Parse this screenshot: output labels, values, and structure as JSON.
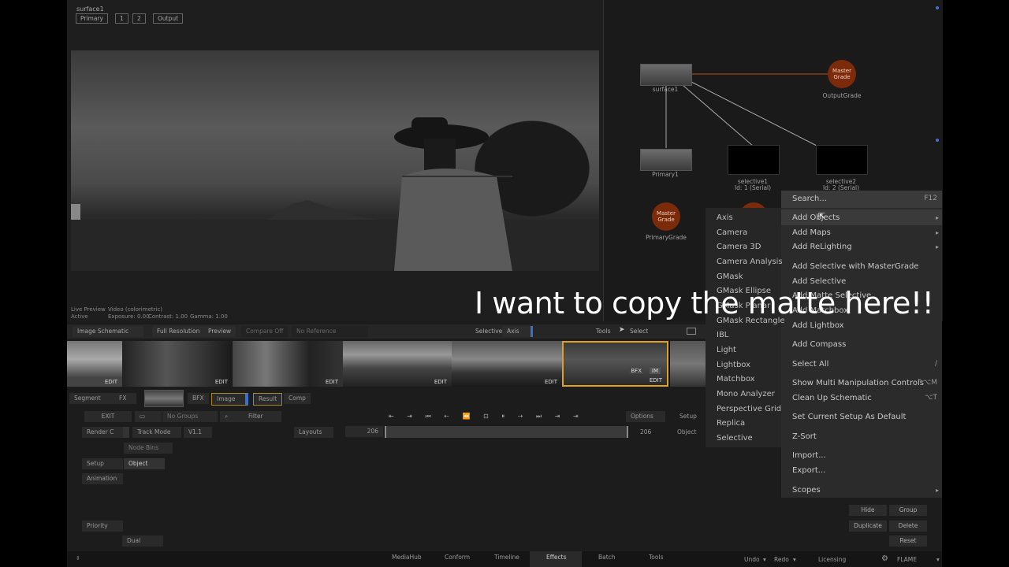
{
  "viewer": {
    "surface_label": "surface1",
    "buttons": [
      "Primary",
      "1",
      "2",
      "Output"
    ],
    "live_preview": "Live Preview",
    "video_mode": "Video (colorimetric)",
    "active": "Active",
    "exposure": "Exposure: 0.00",
    "contrast": "Contrast: 1.00",
    "gamma": "Gamma: 1.00"
  },
  "schematic": {
    "nodes": {
      "surface1": "surface1",
      "output_grade": "OutputGrade",
      "master_grade": "Master Grade",
      "primary1": "Primary1",
      "selective1_name": "selective1",
      "selective1_id": "Id: 1 (Serial)",
      "selective2_name": "selective2",
      "selective2_id": "Id: 2 (Serial)",
      "primary_grade": "PrimaryGrade",
      "primary_grade_circle": "Master Grade"
    }
  },
  "toolbar": {
    "image_schematic": "Image Schematic",
    "full_resolution": "Full Resolution",
    "preview": "Preview",
    "compare_off": "Compare Off",
    "no_reference": "No Reference",
    "selective_label": "Selective",
    "selective_value": "Axis",
    "tools_label": "Tools",
    "select_label": "Select"
  },
  "reel": {
    "edit_labels": [
      "EDIT",
      "EDIT",
      "EDIT",
      "EDIT",
      "EDIT",
      "EDIT"
    ],
    "badges": [
      "BFX",
      "IM"
    ]
  },
  "controls": {
    "segment": "Segment",
    "fx": "FX",
    "bfx": "BFX",
    "image": "Image",
    "result": "Result",
    "comp": "Comp",
    "exit": "EXIT",
    "no_groups": "No Groups",
    "filter": "Filter",
    "options": "Options",
    "setup_right": "Setup",
    "render_c": "Render C",
    "track_mode": "Track Mode",
    "version": "V1.1",
    "layouts": "Layouts",
    "frame_start": "206",
    "frame_end": "206",
    "object_right": "Object",
    "node_bins": "Node Bins",
    "setup": "Setup",
    "object": "Object",
    "animation": "Animation",
    "priority": "Priority",
    "dual": "Dual"
  },
  "right_buttons": {
    "hide": "Hide",
    "group": "Group",
    "duplicate": "Duplicate",
    "delete": "Delete",
    "reset": "Reset"
  },
  "bottom_tabs": [
    "MediaHub",
    "Conform",
    "Timeline",
    "Effects",
    "Batch",
    "Tools"
  ],
  "bottom_right": {
    "undo": "Undo",
    "redo": "Redo",
    "licensing": "Licensing",
    "flame": "FLAME"
  },
  "context_menu": {
    "items": [
      {
        "label": "Search...",
        "shortcut": "F12"
      },
      {
        "label": "Add Objects",
        "submenu": true
      },
      {
        "label": "Add Maps",
        "submenu": true
      },
      {
        "label": "Add ReLighting",
        "submenu": true
      },
      {
        "label": "Add Selective with MasterGrade"
      },
      {
        "label": "Add Selective"
      },
      {
        "label": "Add Matte Selective"
      },
      {
        "label": "Add Matchbox"
      },
      {
        "label": "Add Lightbox"
      },
      {
        "label": "Add Compass"
      },
      {
        "label": "Select All",
        "shortcut": "/"
      },
      {
        "label": "Show Multi Manipulation Controls",
        "shortcut": "^⌥M"
      },
      {
        "label": "Clean Up Schematic",
        "shortcut": "⌥T"
      },
      {
        "label": "Set Current Setup As Default"
      },
      {
        "label": "Z-Sort"
      },
      {
        "label": "Import..."
      },
      {
        "label": "Export..."
      },
      {
        "label": "Scopes",
        "submenu": true
      }
    ]
  },
  "objects_submenu": {
    "items": [
      "Axis",
      "Camera",
      "Camera 3D",
      "Camera Analysis",
      "GMask",
      "GMask Ellipse",
      "GMask Planar",
      "GMask Rectangle",
      "IBL",
      "Light",
      "Lightbox",
      "Matchbox",
      "Mono Analyzer",
      "Perspective Grid",
      "Replica",
      "Selective"
    ]
  },
  "caption": "I want to copy the matte here!!",
  "colors": {
    "node_orange": "#7b2a0a",
    "selected_reel": "#e0a020",
    "accent_blue": "#3a6fd0"
  }
}
